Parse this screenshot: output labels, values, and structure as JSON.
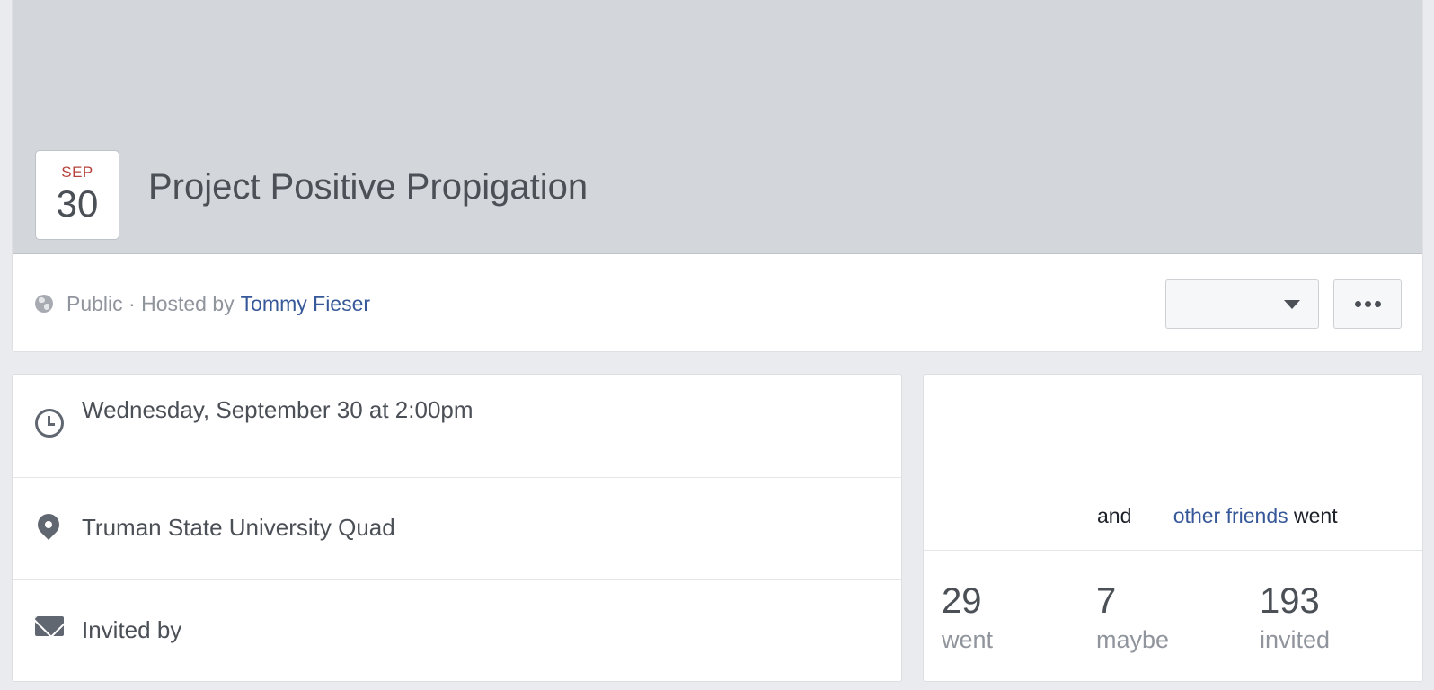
{
  "event": {
    "month": "SEP",
    "day": "30",
    "title": "Project Positive Propigation"
  },
  "info": {
    "privacy": "Public · Hosted by",
    "host": "Tommy Fieser",
    "privacy_icon": "globe-icon"
  },
  "actions": {
    "rsvp_value": "",
    "more_icon": "more-icon"
  },
  "details": {
    "time": "Wednesday, September 30 at 2:00pm",
    "location": "Truman State University Quad",
    "invited": "Invited by"
  },
  "friends": {
    "and": "and",
    "others": "other friends",
    "went": "went"
  },
  "stats": [
    {
      "count": "29",
      "label": "went"
    },
    {
      "count": "7",
      "label": "maybe"
    },
    {
      "count": "193",
      "label": "invited"
    }
  ],
  "colors": {
    "link": "#365899",
    "month": "#b6423b",
    "cover": "#d3d6db"
  }
}
